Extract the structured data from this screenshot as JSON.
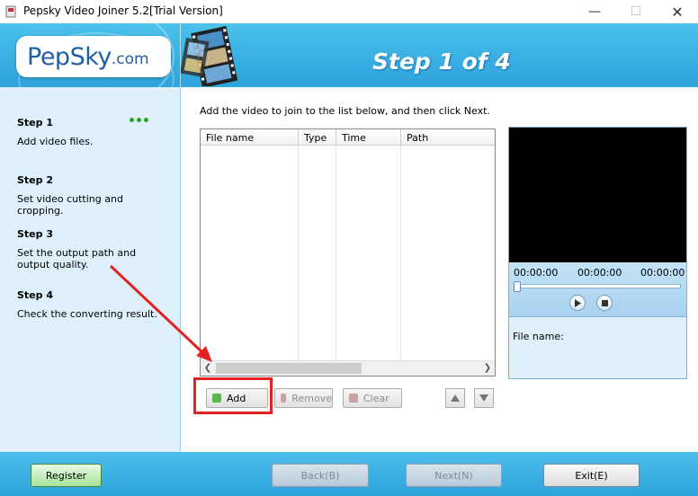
{
  "window": {
    "title": "Pepsky Video Joiner 5.2[Trial Version]",
    "minimize": "—",
    "maximize": "☐",
    "close": "✕"
  },
  "banner": {
    "logo_brand": "PepSky",
    "logo_domain": ".com",
    "step_title": "Step 1 of 4"
  },
  "sidebar": {
    "steps": [
      {
        "label": "Step 1",
        "desc": "Add video files."
      },
      {
        "label": "Step 2",
        "desc": "Set video cutting and cropping."
      },
      {
        "label": "Step 3",
        "desc": "Set the output path and output quality."
      },
      {
        "label": "Step 4",
        "desc": "Check the converting result."
      }
    ]
  },
  "main": {
    "instruction": "Add the video to join to the list below, and then click Next.",
    "columns": [
      "File name",
      "Type",
      "Time",
      "Path"
    ]
  },
  "preview": {
    "time_start": "00:00:00",
    "time_current": "00:00:00",
    "time_end": "00:00:00",
    "file_name_label": "File name:"
  },
  "actions": {
    "add": "Add",
    "remove": "Remove",
    "clear": "Clear"
  },
  "footer": {
    "register": "Register",
    "back": "Back(B)",
    "next": "Next(N)",
    "exit": "Exit(E)"
  },
  "colors": {
    "accent_blue": "#38aee3",
    "highlight_red": "#e52222",
    "register_green": "#a6e39a"
  }
}
